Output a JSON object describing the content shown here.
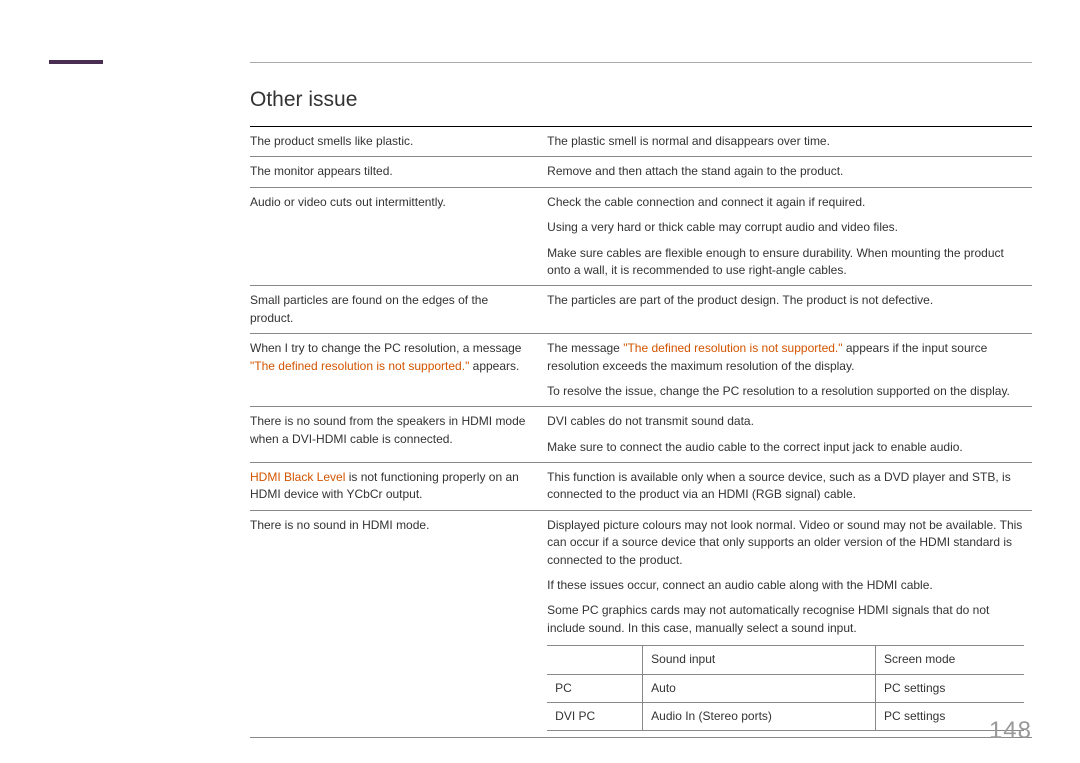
{
  "section_title": "Other issue",
  "page_number": "148",
  "rows": {
    "r1_left": "The product smells like plastic.",
    "r1_right": "The plastic smell is normal and disappears over time.",
    "r2_left": "The monitor appears tilted.",
    "r2_right": "Remove and then attach the stand again to the product.",
    "r3_left": "Audio or video cuts out intermittently.",
    "r3_right_a": "Check the cable connection and connect it again if required.",
    "r3_right_b": "Using a very hard or thick cable may corrupt audio and video files.",
    "r3_right_c": "Make sure cables are flexible enough to ensure durability. When mounting the product onto a wall, it is recommended to use right-angle cables.",
    "r4_left": "Small particles are found on the edges of the product.",
    "r4_right": "The particles are part of the product design. The product is not defective.",
    "r5_left_a": "When I try to change the PC resolution, a message ",
    "r5_left_b": "\"The defined resolution is not supported.\"",
    "r5_left_c": " appears.",
    "r5_right_a1": "The message ",
    "r5_right_a2": "\"The defined resolution is not supported.\"",
    "r5_right_a3": " appears if the input source resolution exceeds the maximum resolution of the display.",
    "r5_right_b": "To resolve the issue, change the PC resolution to a resolution supported on the display.",
    "r6_left": "There is no sound from the speakers in HDMI mode when a DVI-HDMI cable is connected.",
    "r6_right_a": "DVI cables do not transmit sound data.",
    "r6_right_b": "Make sure to connect the audio cable to the correct input jack to enable audio.",
    "r7_left_a": "HDMI Black Level",
    "r7_left_b": " is not functioning properly on an HDMI device with YCbCr output.",
    "r7_right": "This function is available only when a source device, such as a DVD player and STB, is connected to the product via an HDMI (RGB signal) cable.",
    "r8_left": "There is no sound in HDMI mode.",
    "r8_right_a": "Displayed picture colours may not look normal. Video or sound may not be available. This can occur if a source device that only supports an older version of the HDMI standard is connected to the product.",
    "r8_right_b": "If these issues occur, connect an audio cable along with the HDMI cable.",
    "r8_right_c": "Some PC graphics cards may not automatically recognise HDMI signals that do not include sound. In this case, manually select a sound input."
  },
  "subtable": {
    "h1": "",
    "h2": "Sound input",
    "h3": "Screen mode",
    "r1c1": "PC",
    "r1c2": "Auto",
    "r1c3": "PC settings",
    "r2c1": "DVI PC",
    "r2c2": "Audio In (Stereo ports)",
    "r2c3": "PC settings"
  }
}
